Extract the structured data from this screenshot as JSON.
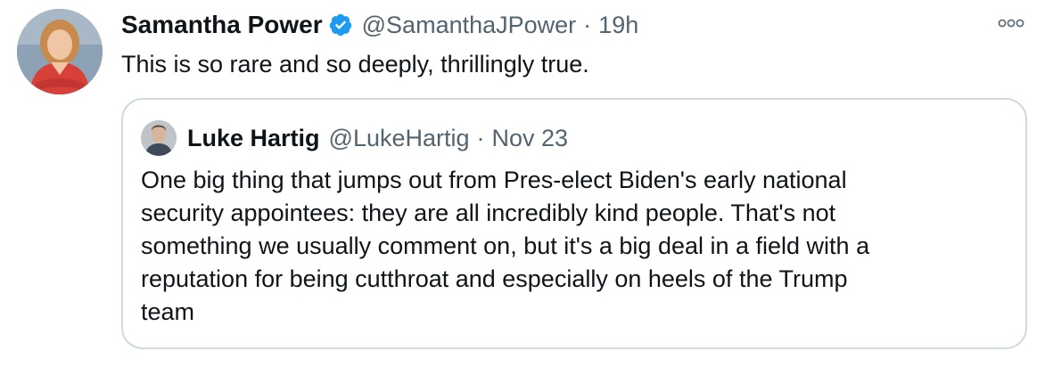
{
  "tweet": {
    "author": {
      "display_name": "Samantha Power",
      "handle": "@SamanthaJPower",
      "verified": true
    },
    "separator": "·",
    "time": "19h",
    "text": "This is so rare and so deeply, thrillingly true.",
    "more_icon": "more-options-icon"
  },
  "quoted_tweet": {
    "author": {
      "display_name": "Luke Hartig",
      "handle": "@LukeHartig"
    },
    "separator": "·",
    "time": "Nov 23",
    "text_lines": [
      "One big thing that jumps out from Pres-elect Biden's early national",
      "security appointees: they are all incredibly kind people. That's not",
      "something we usually comment on, but it's a big deal in a field with a",
      "reputation for being cutthroat and especially on heels of the Trump",
      "team"
    ]
  },
  "colors": {
    "text_primary": "#0f1419",
    "text_secondary": "#536471",
    "verified_blue": "#1d9bf0",
    "border": "#cfd9de",
    "background": "#ffffff"
  }
}
